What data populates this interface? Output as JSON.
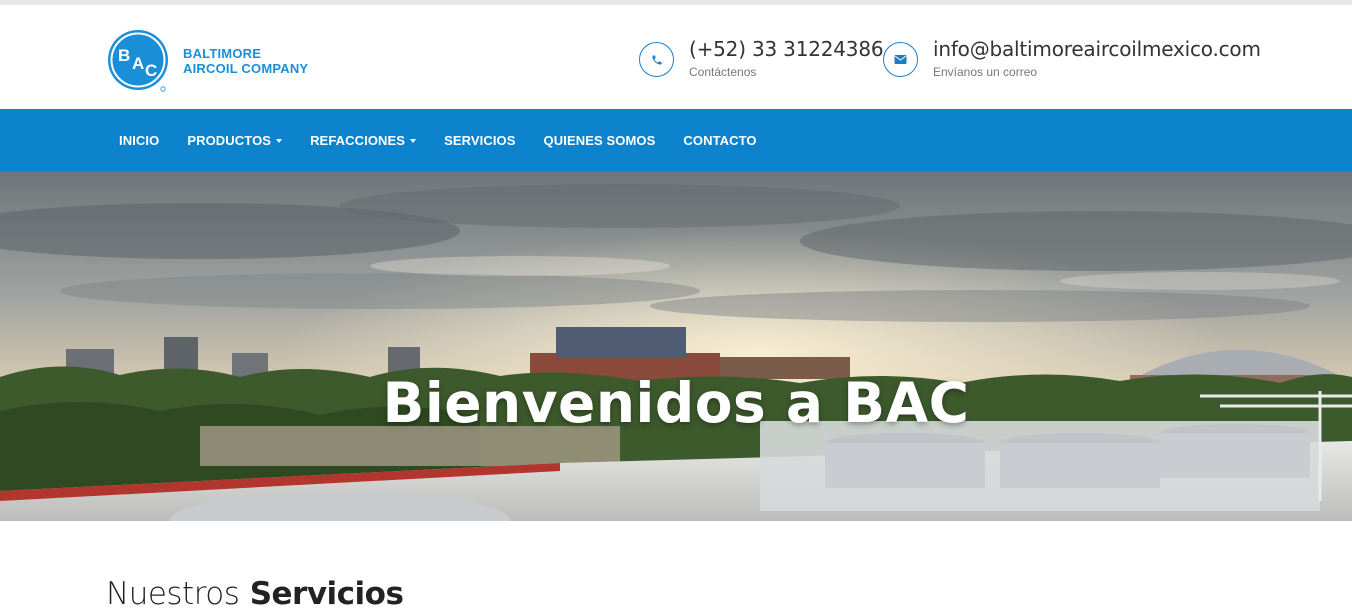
{
  "brand": {
    "line1": "BALTIMORE",
    "line2": "AIRCOIL COMPANY",
    "mark_letters": [
      "B",
      "A",
      "C"
    ],
    "color": "#1a8fd8"
  },
  "contact": {
    "phone": {
      "value": "(+52) 33 31224386",
      "label": "Contáctenos",
      "icon": "phone-icon"
    },
    "email": {
      "value": "info@baltimoreaircoilmexico.com",
      "label": "Envíanos un correo",
      "icon": "envelope-icon"
    }
  },
  "nav": {
    "items": [
      {
        "label": "INICIO",
        "dropdown": false
      },
      {
        "label": "PRODUCTOS",
        "dropdown": true
      },
      {
        "label": "REFACCIONES",
        "dropdown": true
      },
      {
        "label": "SERVICIOS",
        "dropdown": false
      },
      {
        "label": "QUIENES SOMOS",
        "dropdown": false
      },
      {
        "label": "CONTACTO",
        "dropdown": false
      }
    ],
    "background": "#0d83cd"
  },
  "hero": {
    "title": "Bienvenidos a BAC"
  },
  "services": {
    "title_light": "Nuestros",
    "title_bold": "Servicios"
  }
}
